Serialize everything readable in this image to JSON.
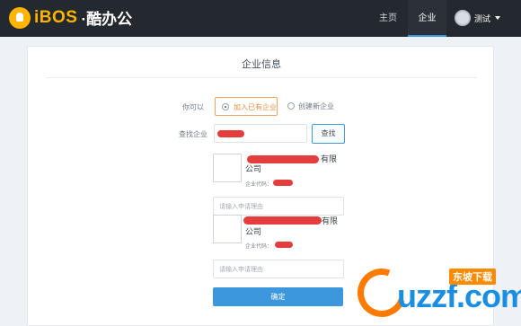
{
  "brand": {
    "logo_text": "iBOS",
    "logo_suffix": "·酷办公"
  },
  "nav": {
    "items": [
      "主页",
      "企业"
    ],
    "active": "企业",
    "user_name": "测试"
  },
  "panel": {
    "title": "企业信息",
    "choice_label": "你可以",
    "option_join": "加入已有企业",
    "option_create": "创建新企业",
    "search_label": "查找企业",
    "search_button": "查找",
    "companies": [
      {
        "name_suffix": "有限",
        "name_line2": "公司",
        "code_label": "企业代码：",
        "reason_placeholder": "请输入申请理由"
      },
      {
        "name_suffix": "有限",
        "name_line2": "公司",
        "code_label": "企业代码：",
        "reason_placeholder": "请输入申请理由"
      }
    ],
    "confirm_button": "确定"
  },
  "watermark": {
    "text": "uzzf.com",
    "tag": "东坡下载"
  },
  "colors": {
    "topbar": "#24282f",
    "accent": "#3d97dc",
    "orange": "#f0a465",
    "redaction": "#e33d3d"
  }
}
